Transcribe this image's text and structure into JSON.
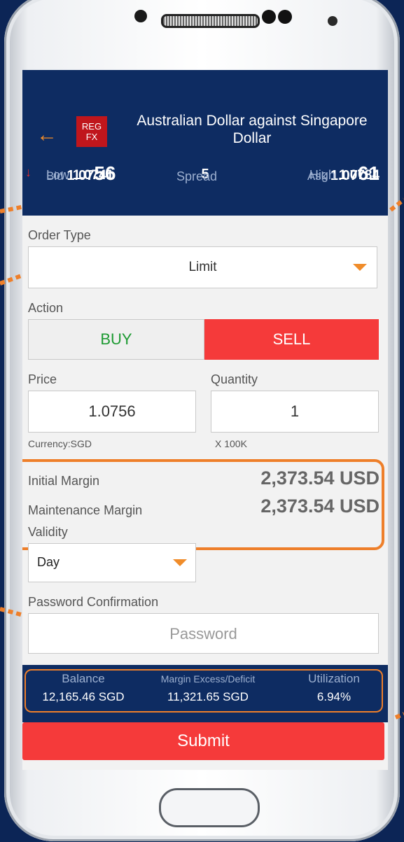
{
  "header": {
    "badge_line1": "REG",
    "badge_line2": "FX",
    "title": "Australian Dollar against Singapore Dollar"
  },
  "quote": {
    "bid_label": "Bid",
    "bid_prefix": "1.07",
    "bid_suffix": "56",
    "spread_value": "5",
    "ask_label": "Ask",
    "ask_prefix": "1.07",
    "ask_suffix": "61",
    "low_label": "Low",
    "low_value": "1.0741",
    "spread_label": "Spread",
    "high_label": "High",
    "high_value": "1.0784"
  },
  "form": {
    "order_type_label": "Order Type",
    "order_type_value": "Limit",
    "action_label": "Action",
    "buy_label": "BUY",
    "sell_label": "SELL",
    "price_label": "Price",
    "price_value": "1.0756",
    "quantity_label": "Quantity",
    "quantity_value": "1",
    "currency_note": "Currency:SGD",
    "quantity_unit": "X 100K",
    "initial_margin_label": "Initial Margin",
    "initial_margin_value": "2,373.54 USD",
    "maintenance_margin_label": "Maintenance Margin",
    "maintenance_margin_value": "2,373.54 USD",
    "validity_label": "Validity",
    "validity_value": "Day",
    "password_label": "Password Confirmation",
    "password_placeholder": "Password"
  },
  "summary": {
    "balance_label": "Balance",
    "balance_value": "12,165.46 SGD",
    "margin_label": "Margin Excess/Deficit",
    "margin_value": "11,321.65 SGD",
    "utilization_label": "Utilization",
    "utilization_value": "6.94%"
  },
  "submit_label": "Submit",
  "colors": {
    "navy": "#0e2c62",
    "accent_orange": "#ee7f2a",
    "sell_red": "#f53a3a",
    "buy_green": "#1d9a32"
  }
}
